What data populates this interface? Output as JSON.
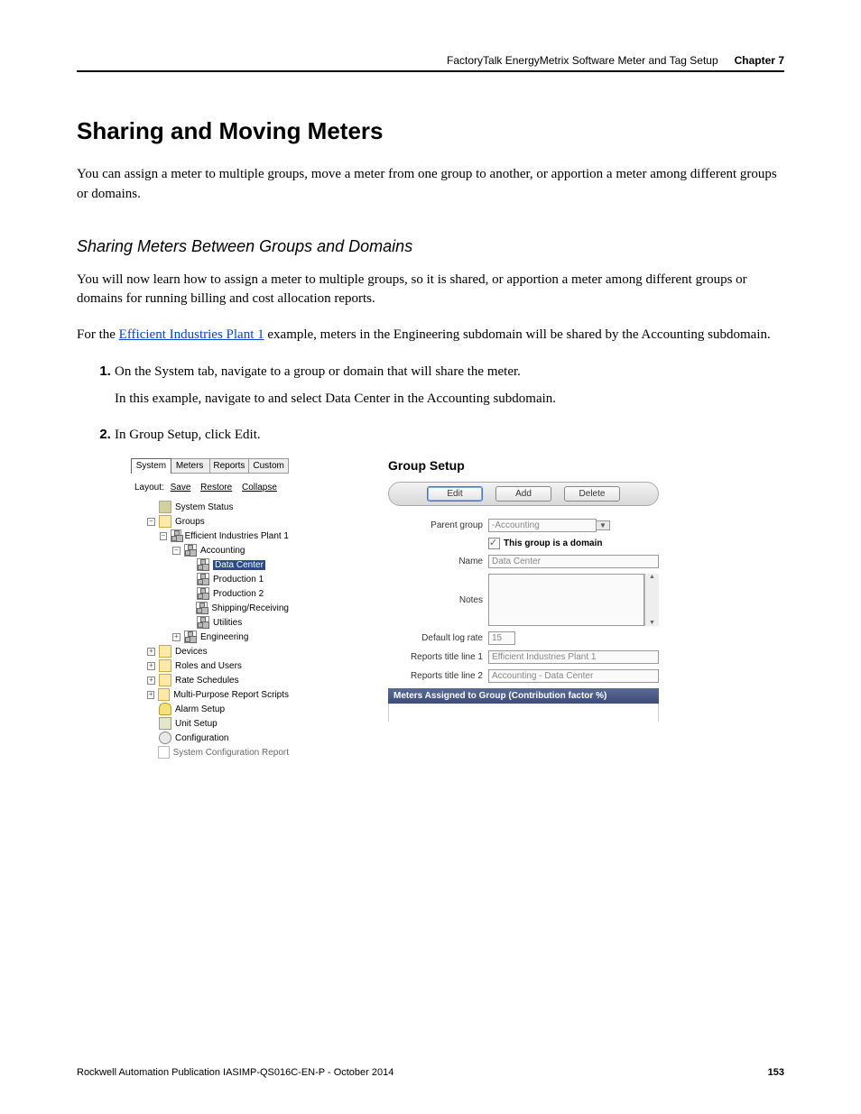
{
  "header": {
    "topic": "FactoryTalk EnergyMetrix Software Meter and Tag Setup",
    "chapter": "Chapter 7"
  },
  "h1": "Sharing and Moving Meters",
  "intro": "You can assign a meter to multiple groups, move a meter from one group to another, or apportion a meter among different groups or domains.",
  "h2": "Sharing Meters Between Groups and Domains",
  "p2": "You will now learn how to assign a meter to multiple groups, so it is shared, or apportion a meter among different groups or domains for running billing and cost allocation reports.",
  "p3_before": "For the ",
  "p3_link": "Efficient Industries Plant 1",
  "p3_after": " example, meters in the Engineering subdomain will be shared by the Accounting subdomain.",
  "steps": {
    "s1": "On the System tab, navigate to a group or domain that will share the meter.",
    "s1_sub": "In this example, navigate to and select Data Center in the Accounting subdomain.",
    "s2": "In Group Setup, click Edit."
  },
  "tabs": [
    "System",
    "Meters",
    "Reports",
    "Custom"
  ],
  "layout": {
    "label": "Layout:",
    "links": [
      "Save",
      "Restore",
      "Collapse"
    ]
  },
  "tree": {
    "system_status": "System Status",
    "groups": "Groups",
    "plant": "Efficient Industries Plant 1",
    "accounting": "Accounting",
    "data_center": "Data Center",
    "prod1": "Production 1",
    "prod2": "Production 2",
    "ship": "Shipping/Receiving",
    "util": "Utilities",
    "eng": "Engineering",
    "devices": "Devices",
    "roles": "Roles and Users",
    "rates": "Rate Schedules",
    "mprs": "Multi-Purpose Report Scripts",
    "alarm": "Alarm Setup",
    "unit": "Unit Setup",
    "config": "Configuration",
    "syscfg": "System Configuration Report"
  },
  "form": {
    "title": "Group Setup",
    "buttons": {
      "edit": "Edit",
      "add": "Add",
      "delete": "Delete"
    },
    "labels": {
      "parent": "Parent group",
      "domain": "This group is a domain",
      "name": "Name",
      "notes": "Notes",
      "lograte": "Default log rate",
      "rt1": "Reports title line 1",
      "rt2": "Reports title line 2",
      "meters": "Meters Assigned to Group (Contribution factor %)"
    },
    "values": {
      "parent": "-Accounting",
      "name": "Data Center",
      "lograte": "15",
      "rt1": "Efficient Industries Plant 1",
      "rt2": "Accounting - Data Center"
    }
  },
  "footer": {
    "pub": "Rockwell Automation Publication IASIMP-QS016C-EN-P - October 2014",
    "page": "153"
  }
}
